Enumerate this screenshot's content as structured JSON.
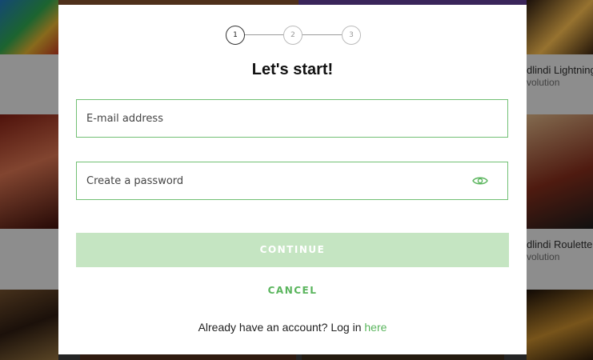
{
  "background_games": [
    {
      "title": "dlindi Lightning",
      "provider": "volution"
    },
    {
      "title": "dlindi Roulette L",
      "provider": "volution"
    }
  ],
  "signup_modal": {
    "steps": [
      "1",
      "2",
      "3"
    ],
    "active_step": "1",
    "title": "Let's start!",
    "email_placeholder": "E-mail address",
    "email_value": "",
    "password_placeholder": "Create a password",
    "password_value": "",
    "continue_label": "CONTINUE",
    "cancel_label": "CANCEL",
    "login_prompt": "Already have an account? Log in",
    "login_link": "here",
    "show_password_icon": "eye-icon"
  },
  "colors": {
    "accent": "#5ab55d",
    "field_border": "#72c074",
    "continue_disabled": "#c5e5c2"
  }
}
